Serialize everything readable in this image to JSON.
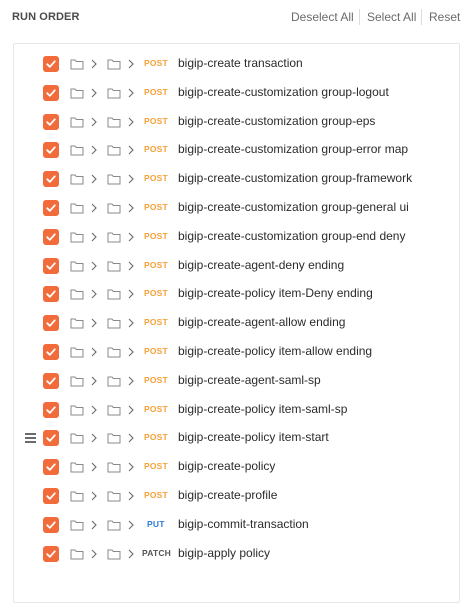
{
  "header": {
    "title": "RUN ORDER",
    "deselect_all": "Deselect All",
    "select_all": "Select All",
    "reset": "Reset"
  },
  "colors": {
    "checkbox": "#f26b3a",
    "post": "#f5a13b",
    "put": "#2f7ad8",
    "patch": "#555555"
  },
  "requests": [
    {
      "method": "POST",
      "name": "bigip-create transaction",
      "checked": true
    },
    {
      "method": "POST",
      "name": "bigip-create-customization group-logout",
      "checked": true
    },
    {
      "method": "POST",
      "name": "bigip-create-customization group-eps",
      "checked": true
    },
    {
      "method": "POST",
      "name": "bigip-create-customization group-error map",
      "checked": true
    },
    {
      "method": "POST",
      "name": "bigip-create-customization group-framework",
      "checked": true
    },
    {
      "method": "POST",
      "name": "bigip-create-customization group-general ui",
      "checked": true
    },
    {
      "method": "POST",
      "name": "bigip-create-customization group-end deny",
      "checked": true
    },
    {
      "method": "POST",
      "name": "bigip-create-agent-deny ending",
      "checked": true
    },
    {
      "method": "POST",
      "name": "bigip-create-policy item-Deny ending",
      "checked": true
    },
    {
      "method": "POST",
      "name": "bigip-create-agent-allow ending",
      "checked": true
    },
    {
      "method": "POST",
      "name": "bigip-create-policy item-allow ending",
      "checked": true
    },
    {
      "method": "POST",
      "name": "bigip-create-agent-saml-sp",
      "checked": true
    },
    {
      "method": "POST",
      "name": "bigip-create-policy item-saml-sp",
      "checked": true
    },
    {
      "method": "POST",
      "name": "bigip-create-policy item-start",
      "checked": true,
      "drag_handle": true
    },
    {
      "method": "POST",
      "name": "bigip-create-policy",
      "checked": true
    },
    {
      "method": "POST",
      "name": "bigip-create-profile",
      "checked": true
    },
    {
      "method": "PUT",
      "name": "bigip-commit-transaction",
      "checked": true
    },
    {
      "method": "PATCH",
      "name": "bigip-apply policy",
      "checked": true
    }
  ]
}
